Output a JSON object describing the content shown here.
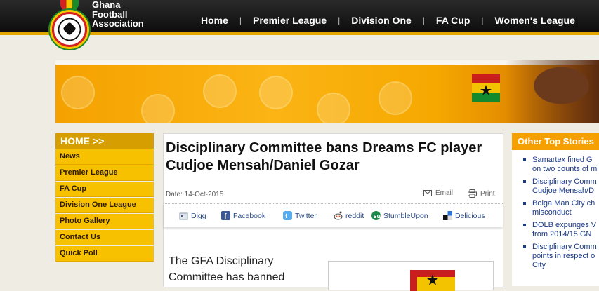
{
  "logo": {
    "line1": "Ghana",
    "line2": "Football",
    "line3": "Association"
  },
  "nav": [
    "Home",
    "Premier League",
    "Division One",
    "FA Cup",
    "Women's League"
  ],
  "sidebar": {
    "heading": "HOME >>",
    "items": [
      "News",
      "Premier League",
      "FA Cup",
      "Division One League",
      "Photo Gallery",
      "Contact Us",
      "Quick Poll"
    ]
  },
  "article": {
    "title": "Disciplinary Committee bans Dreams FC player Cudjoe Mensah/Daniel Gozar",
    "date": "Date: 14-Oct-2015",
    "email": "Email",
    "print": "Print",
    "share": [
      "Digg",
      "Facebook",
      "Twitter",
      "reddit",
      "StumbleUpon",
      "Delicious"
    ],
    "body_line1": "The GFA Disciplinary",
    "body_line2": "Committee has banned"
  },
  "stories": {
    "heading": "Other Top Stories",
    "items": [
      {
        "l1": "Samartex fined G",
        "l2": "on two counts of m"
      },
      {
        "l1": "Disciplinary Comm",
        "l2": "Cudjoe Mensah/D"
      },
      {
        "l1": "Bolga Man City ch",
        "l2": "misconduct"
      },
      {
        "l1": "DOLB expunges V",
        "l2": "from 2014/15 GN"
      },
      {
        "l1": "Disciplinary Comm",
        "l2": "points in respect o",
        "l3": "City"
      }
    ]
  },
  "colors": {
    "accent": "#f5a000",
    "nav_bg": "#111111",
    "sidebar": "#f8c100"
  }
}
